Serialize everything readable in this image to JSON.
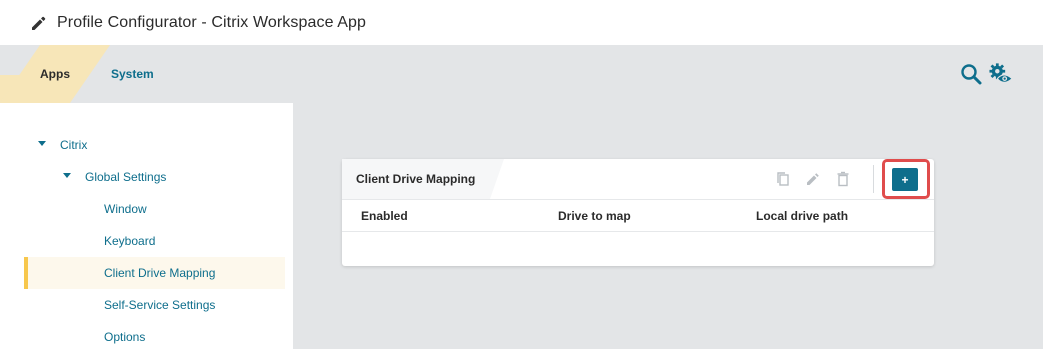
{
  "window": {
    "title": "Profile Configurator  - Citrix Workspace App",
    "icon": "pencil-icon"
  },
  "tabs": [
    {
      "label": "Apps",
      "active": true
    },
    {
      "label": "System",
      "active": false
    }
  ],
  "toolbar_icons": [
    "search-icon",
    "settings-eye-icon"
  ],
  "colors": {
    "accent": "#0e6e8c",
    "active_tab": "#f7e6b8",
    "selection_border": "#f7c74c",
    "highlight_box": "#e04c4c",
    "background": "#e3e5e7"
  },
  "tree": {
    "root": {
      "label": "Citrix",
      "expanded": true
    },
    "global_settings": {
      "label": "Global Settings",
      "expanded": true
    },
    "children": [
      {
        "label": "Window"
      },
      {
        "label": "Keyboard"
      },
      {
        "label": "Client Drive Mapping",
        "selected": true
      },
      {
        "label": "Self-Service Settings"
      },
      {
        "label": "Options"
      }
    ]
  },
  "panel": {
    "title": "Client Drive Mapping",
    "tools": [
      "copy-icon",
      "edit-icon",
      "delete-icon"
    ],
    "add_label": "+",
    "columns": [
      "Enabled",
      "Drive to map",
      "Local drive path"
    ],
    "rows": []
  }
}
